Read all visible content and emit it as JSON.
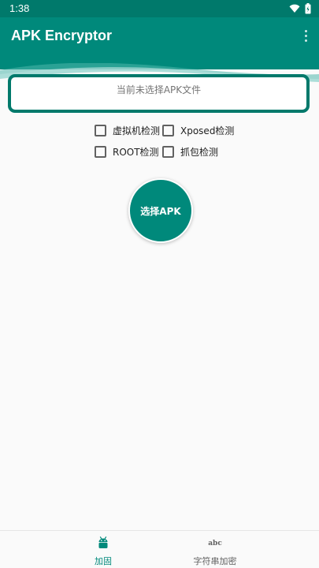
{
  "status_bar": {
    "time": "1:38",
    "wifi_icon": "wifi-icon",
    "battery_icon": "battery-charging-icon"
  },
  "app_bar": {
    "title": "APK Encryptor",
    "overflow_icon": "more-vert-icon"
  },
  "file_status": {
    "text": "当前未选择APK文件"
  },
  "options": {
    "vm_detect": {
      "label": "虚拟机检测",
      "checked": false
    },
    "xposed_detect": {
      "label": "Xposed检测",
      "checked": false
    },
    "root_detect": {
      "label": "ROOT检测",
      "checked": false
    },
    "capture_detect": {
      "label": "抓包检测",
      "checked": false
    }
  },
  "select_button": {
    "label": "选择APK"
  },
  "bottom_nav": {
    "items": [
      {
        "label": "加固",
        "icon": "android-icon",
        "active": true
      },
      {
        "label": "字符串加密",
        "icon": "abc-icon",
        "active": false,
        "icon_text": "abc"
      }
    ]
  },
  "colors": {
    "primary": "#00897b",
    "primary_dark": "#00796b",
    "accent_active": "#00897b",
    "inactive": "#616161"
  }
}
